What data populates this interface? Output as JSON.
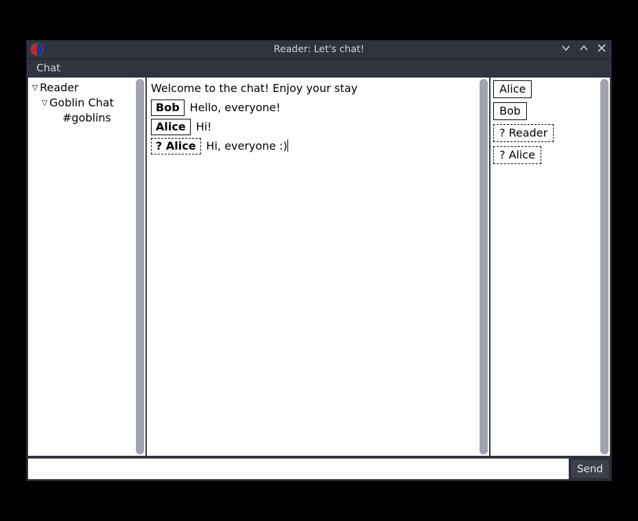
{
  "window": {
    "title": "Reader: Let's chat!"
  },
  "menubar": {
    "chat": "Chat"
  },
  "tree": {
    "root": {
      "label": "Reader",
      "expanded": true
    },
    "server": {
      "label": "Goblin Chat",
      "expanded": true
    },
    "channel": {
      "label": "#goblins"
    }
  },
  "chat": {
    "welcome": "Welcome to the chat!  Enjoy your stay",
    "messages": [
      {
        "sender": "Bob",
        "unverified": false,
        "text": "Hello, everyone!"
      },
      {
        "sender": "Alice",
        "unverified": false,
        "text": "Hi!"
      },
      {
        "sender": "? Alice",
        "unverified": true,
        "text": "Hi, everyone :)"
      }
    ]
  },
  "users": [
    {
      "name": "Alice",
      "unverified": false
    },
    {
      "name": "Bob",
      "unverified": false
    },
    {
      "name": "? Reader",
      "unverified": true
    },
    {
      "name": "? Alice",
      "unverified": true
    }
  ],
  "input": {
    "value": "",
    "send_label": "Send"
  }
}
